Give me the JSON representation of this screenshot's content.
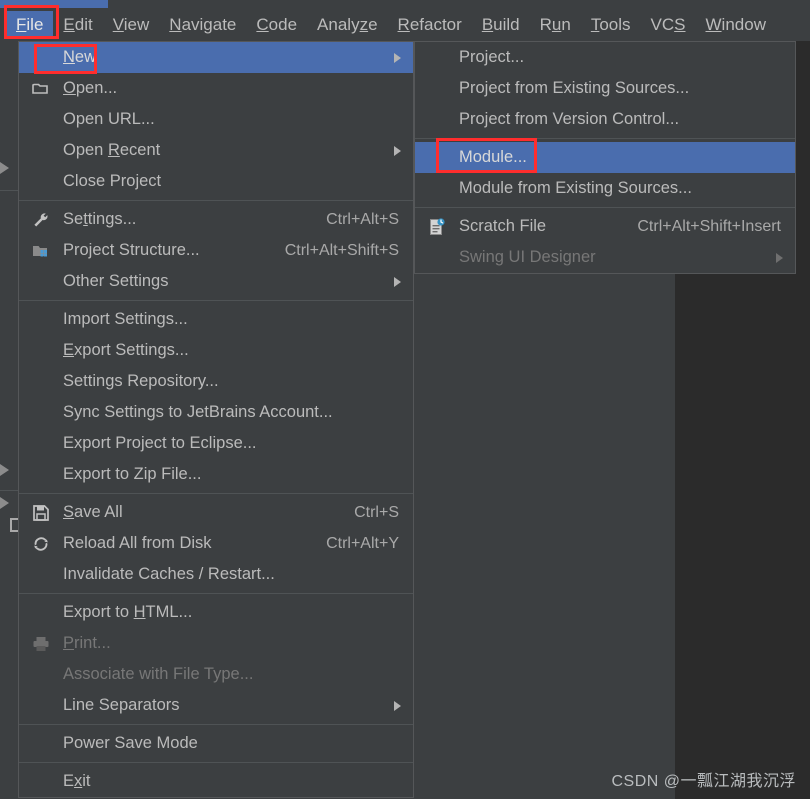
{
  "app": {
    "theme_background": "#2b2b2b",
    "panel_background": "#3c3f41",
    "highlight_color": "#4a6dae",
    "annotation_color": "#ff2d2d",
    "text_color": "#bbbbbb",
    "disabled_text_color": "#777777"
  },
  "menubar": {
    "items": [
      {
        "label": "File",
        "mnemonic": "F",
        "active": true
      },
      {
        "label": "Edit",
        "mnemonic": "E",
        "active": false
      },
      {
        "label": "View",
        "mnemonic": "V",
        "active": false
      },
      {
        "label": "Navigate",
        "mnemonic": "N",
        "active": false
      },
      {
        "label": "Code",
        "mnemonic": "C",
        "active": false
      },
      {
        "label": "Analyze",
        "mnemonic": "z",
        "active": false
      },
      {
        "label": "Refactor",
        "mnemonic": "R",
        "active": false
      },
      {
        "label": "Build",
        "mnemonic": "B",
        "active": false
      },
      {
        "label": "Run",
        "mnemonic": "u",
        "active": false
      },
      {
        "label": "Tools",
        "mnemonic": "T",
        "active": false
      },
      {
        "label": "VCS",
        "mnemonic": "S",
        "active": false
      },
      {
        "label": "Window",
        "mnemonic": "W",
        "active": false
      }
    ]
  },
  "file_menu": {
    "items": [
      {
        "label": "New",
        "mnemonic": "N",
        "accel": "",
        "icon": "",
        "submenu": true,
        "selected": true,
        "disabled": false
      },
      {
        "separator": false,
        "label": "Open...",
        "mnemonic": "O",
        "accel": "",
        "icon": "folder-icon",
        "submenu": false,
        "selected": false,
        "disabled": false
      },
      {
        "label": "Open URL...",
        "mnemonic": "",
        "accel": "",
        "icon": "",
        "submenu": false,
        "selected": false,
        "disabled": false
      },
      {
        "label": "Open Recent",
        "mnemonic": "R",
        "accel": "",
        "icon": "",
        "submenu": true,
        "selected": false,
        "disabled": false
      },
      {
        "label": "Close Project",
        "mnemonic": "",
        "accel": "",
        "icon": "",
        "submenu": false,
        "selected": false,
        "disabled": false
      },
      {
        "label": "Settings...",
        "mnemonic": "t",
        "accel": "Ctrl+Alt+S",
        "icon": "wrench-icon",
        "submenu": false,
        "selected": false,
        "disabled": false
      },
      {
        "label": "Project Structure...",
        "mnemonic": "",
        "accel": "Ctrl+Alt+Shift+S",
        "icon": "modules-icon",
        "submenu": false,
        "selected": false,
        "disabled": false
      },
      {
        "label": "Other Settings",
        "mnemonic": "",
        "accel": "",
        "icon": "",
        "submenu": true,
        "selected": false,
        "disabled": false
      },
      {
        "label": "Import Settings...",
        "mnemonic": "",
        "accel": "",
        "icon": "",
        "submenu": false,
        "selected": false,
        "disabled": false
      },
      {
        "label": "Export Settings...",
        "mnemonic": "E",
        "accel": "",
        "icon": "",
        "submenu": false,
        "selected": false,
        "disabled": false
      },
      {
        "label": "Settings Repository...",
        "mnemonic": "",
        "accel": "",
        "icon": "",
        "submenu": false,
        "selected": false,
        "disabled": false
      },
      {
        "label": "Sync Settings to JetBrains Account...",
        "mnemonic": "",
        "accel": "",
        "icon": "",
        "submenu": false,
        "selected": false,
        "disabled": false
      },
      {
        "label": "Export Project to Eclipse...",
        "mnemonic": "",
        "accel": "",
        "icon": "",
        "submenu": false,
        "selected": false,
        "disabled": false
      },
      {
        "label": "Export to Zip File...",
        "mnemonic": "",
        "accel": "",
        "icon": "",
        "submenu": false,
        "selected": false,
        "disabled": false
      },
      {
        "label": "Save All",
        "mnemonic": "S",
        "accel": "Ctrl+S",
        "icon": "save-icon",
        "submenu": false,
        "selected": false,
        "disabled": false
      },
      {
        "label": "Reload All from Disk",
        "mnemonic": "",
        "accel": "Ctrl+Alt+Y",
        "icon": "reload-icon",
        "submenu": false,
        "selected": false,
        "disabled": false
      },
      {
        "label": "Invalidate Caches / Restart...",
        "mnemonic": "",
        "accel": "",
        "icon": "",
        "submenu": false,
        "selected": false,
        "disabled": false
      },
      {
        "label": "Export to HTML...",
        "mnemonic": "H",
        "accel": "",
        "icon": "",
        "submenu": false,
        "selected": false,
        "disabled": false
      },
      {
        "label": "Print...",
        "mnemonic": "P",
        "accel": "",
        "icon": "printer-icon",
        "submenu": false,
        "selected": false,
        "disabled": true
      },
      {
        "label": "Associate with File Type...",
        "mnemonic": "",
        "accel": "",
        "icon": "",
        "submenu": false,
        "selected": false,
        "disabled": true
      },
      {
        "label": "Line Separators",
        "mnemonic": "",
        "accel": "",
        "icon": "",
        "submenu": true,
        "selected": false,
        "disabled": false
      },
      {
        "label": "Power Save Mode",
        "mnemonic": "",
        "accel": "",
        "icon": "",
        "submenu": false,
        "selected": false,
        "disabled": false
      },
      {
        "label": "Exit",
        "mnemonic": "x",
        "accel": "",
        "icon": "",
        "submenu": false,
        "selected": false,
        "disabled": false
      }
    ]
  },
  "new_submenu": {
    "items": [
      {
        "label": "Project...",
        "mnemonic": "",
        "accel": "",
        "icon": "",
        "submenu": false,
        "selected": false,
        "disabled": false
      },
      {
        "label": "Project from Existing Sources...",
        "mnemonic": "",
        "accel": "",
        "icon": "",
        "submenu": false,
        "selected": false,
        "disabled": false
      },
      {
        "label": "Project from Version Control...",
        "mnemonic": "",
        "accel": "",
        "icon": "",
        "submenu": false,
        "selected": false,
        "disabled": false
      },
      {
        "label": "Module...",
        "mnemonic": "",
        "accel": "",
        "icon": "",
        "submenu": false,
        "selected": true,
        "disabled": false
      },
      {
        "label": "Module from Existing Sources...",
        "mnemonic": "",
        "accel": "",
        "icon": "",
        "submenu": false,
        "selected": false,
        "disabled": false
      },
      {
        "label": "Scratch File",
        "mnemonic": "",
        "accel": "Ctrl+Alt+Shift+Insert",
        "icon": "scratch-file-icon",
        "submenu": false,
        "selected": false,
        "disabled": false
      },
      {
        "label": "Swing UI Designer",
        "mnemonic": "",
        "accel": "",
        "icon": "",
        "submenu": true,
        "selected": false,
        "disabled": true
      }
    ]
  },
  "watermark": {
    "text": "CSDN @一瓢江湖我沉浮"
  }
}
